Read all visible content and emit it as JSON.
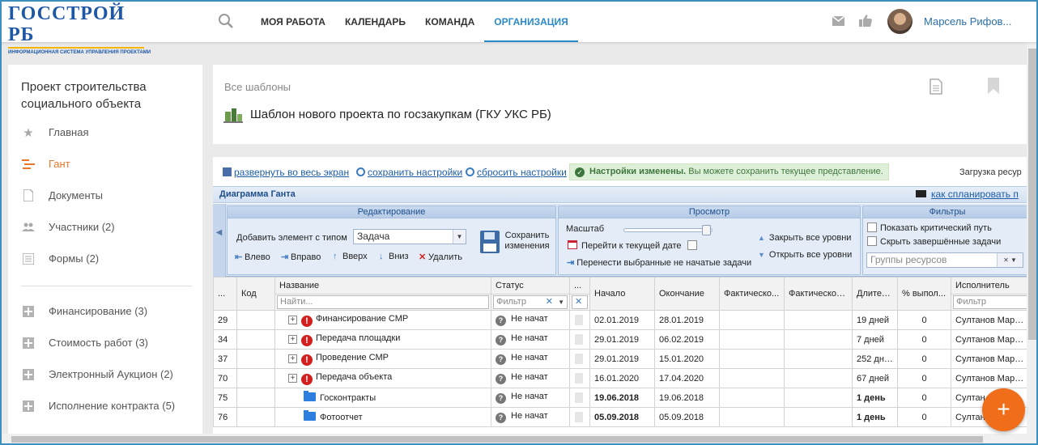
{
  "logo": {
    "title": "ГОССТРОЙ РБ",
    "subtitle": "ИНФОРМАЦИОННАЯ СИСТЕМА УПРАВЛЕНИЯ ПРОЕКТАМИ"
  },
  "nav": {
    "items": [
      "МОЯ РАБОТА",
      "КАЛЕНДАРЬ",
      "КОМАНДА",
      "ОРГАНИЗАЦИЯ"
    ],
    "active": "ОРГАНИЗАЦИЯ"
  },
  "user": {
    "name": "Марсель Рифов..."
  },
  "sidebar": {
    "project_title": "Проект строительства социального объекта",
    "items": [
      {
        "label": "Главная",
        "icon": "star-icon"
      },
      {
        "label": "Гант",
        "icon": "gantt-icon",
        "active": true
      },
      {
        "label": "Документы",
        "icon": "document-icon"
      },
      {
        "label": "Участники (2)",
        "icon": "people-icon"
      },
      {
        "label": "Формы (2)",
        "icon": "form-icon"
      },
      {
        "label": "Финансирование (3)",
        "icon": "plus-square-icon"
      },
      {
        "label": "Стоимость работ (3)",
        "icon": "plus-square-icon"
      },
      {
        "label": "Электронный Аукцион (2)",
        "icon": "plus-square-icon"
      },
      {
        "label": "Исполнение контракта (5)",
        "icon": "plus-square-icon"
      }
    ]
  },
  "header": {
    "breadcrumb": "Все шаблоны",
    "title": "Шаблон нового проекта по госзакупкам (ГКУ УКС РБ)"
  },
  "toolbar": {
    "fullscreen": "развернуть во весь экран",
    "save_settings": "сохранить настройки",
    "reset_settings": "сбросить настройки",
    "notice_bold": "Настройки изменены.",
    "notice_text": " Вы можете сохранить текущее представление.",
    "resource_load": "Загрузка ресур"
  },
  "gantt": {
    "title": "Диаграмма Ганта",
    "howto": "как спланировать п"
  },
  "ribbon": {
    "edit": {
      "title": "Редактирование",
      "add_label": "Добавить элемент с типом",
      "type_value": "Задача",
      "save_label": "Сохранить изменения",
      "left": "Влево",
      "right": "Вправо",
      "up": "Вверх",
      "down": "Вниз",
      "delete": "Удалить"
    },
    "view": {
      "title": "Просмотр",
      "scale": "Масштаб",
      "goto_date": "Перейти к текущей дате",
      "move_tasks": "Перенести выбранные не начатые задачи",
      "collapse": "Закрыть все уровни",
      "expand": "Открыть все уровни",
      "scale_level": 0.9
    },
    "filters": {
      "title": "Фильтры",
      "critical": "Показать критический путь",
      "hide_done": "Скрыть завершённые задачи",
      "groups_placeholder": "Группы ресурсов"
    }
  },
  "table": {
    "headers": [
      "...",
      "Код",
      "Название",
      "Статус",
      "...",
      "Начало",
      "Окончание",
      "Фактическо...",
      "Фактическое...",
      "Длител...",
      "% выпол...",
      "Исполнитель"
    ],
    "filters": {
      "name": "Найти...",
      "status": "Фильтр",
      "executor": "Фильтр"
    },
    "rows": [
      {
        "id": "29",
        "name": "Финансирование СМР",
        "status": "Не начат",
        "start": "02.01.2019",
        "end": "28.01.2019",
        "duration": "19 дней",
        "percent": "0",
        "executor": "Султанов Марсе..."
      },
      {
        "id": "34",
        "name": "Передача площадки",
        "status": "Не начат",
        "start": "29.01.2019",
        "end": "06.02.2019",
        "duration": "7 дней",
        "percent": "0",
        "executor": "Султанов Марсе..."
      },
      {
        "id": "37",
        "name": "Проведение СМР",
        "status": "Не начат",
        "start": "29.01.2019",
        "end": "15.01.2020",
        "duration": "252 дней",
        "percent": "0",
        "executor": "Султанов Марсе..."
      },
      {
        "id": "70",
        "name": "Передача объекта",
        "status": "Не начат",
        "start": "16.01.2020",
        "end": "17.04.2020",
        "duration": "67 дней",
        "percent": "0",
        "executor": "Султанов Марсе..."
      },
      {
        "id": "75",
        "name": "Госконтракты",
        "status": "Не начат",
        "start": "19.06.2018",
        "end": "19.06.2018",
        "duration": "1 день",
        "percent": "0",
        "executor": "Султан..."
      },
      {
        "id": "76",
        "name": "Фотоотчет",
        "status": "Не начат",
        "start": "05.09.2018",
        "end": "05.09.2018",
        "duration": "1 день",
        "percent": "0",
        "executor": "Султан..."
      }
    ]
  },
  "fab": {
    "label": "+"
  }
}
